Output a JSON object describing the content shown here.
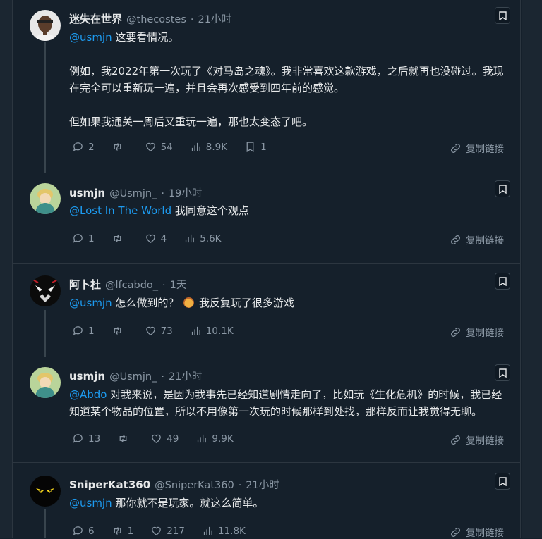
{
  "posts": [
    {
      "name": "迷失在世界",
      "handle": "@thecostes",
      "time": "21小时",
      "mention": "@usmjn",
      "paragraphs": [
        "这要看情况。",
        "例如，我2022年第一次玩了《对马岛之魂》。我非常喜欢这款游戏，之后就再也没碰过。我现在完全可以重新玩一遍，并且会再次感受到四年前的感觉。",
        "但如果我通关一周后又重玩一遍，那也太变态了吧。"
      ],
      "replies": "2",
      "retweets": "",
      "likes": "54",
      "views": "8.9K",
      "bookmarks": "1",
      "copy_link": "复制链接"
    },
    {
      "name": "usmjn",
      "handle": "@Usmjn_",
      "time": "19小时",
      "mention": "@Lost In The World",
      "text": "我同意这个观点",
      "replies": "1",
      "retweets": "",
      "likes": "4",
      "views": "5.6K",
      "copy_link": "复制链接"
    },
    {
      "name": "阿卜杜",
      "handle": "@lfcabdo_",
      "time": "1天",
      "mention": "@usmjn",
      "text_before": "怎么做到的？",
      "text_after": "我反复玩了很多游戏",
      "replies": "1",
      "retweets": "",
      "likes": "73",
      "views": "10.1K",
      "copy_link": "复制链接"
    },
    {
      "name": "usmjn",
      "handle": "@Usmjn_",
      "time": "21小时",
      "mention": "@Abdo",
      "text": "对我来说，是因为我事先已经知道剧情走向了，比如玩《生化危机》的时候，我已经知道某个物品的位置，所以不用像第一次玩的时候那样到处找，那样反而让我觉得无聊。",
      "replies": "13",
      "retweets": "",
      "likes": "49",
      "views": "9.9K",
      "copy_link": "复制链接"
    },
    {
      "name": "SniperKat360",
      "handle": "@SniperKat360",
      "time": "21小时",
      "mention": "@usmjn",
      "text": "那你就不是玩家。就这么简单。",
      "replies": "6",
      "retweets": "1",
      "likes": "217",
      "views": "11.8K",
      "copy_link": "复制链接"
    }
  ],
  "separator_dot": "·",
  "icons": {
    "reply": "reply-icon",
    "retweet": "retweet-icon",
    "like": "heart-icon",
    "views": "views-icon",
    "bookmark": "bookmark-icon",
    "link": "link-icon"
  },
  "colors": {
    "background": "#15202b",
    "mention": "#1d9bf0",
    "muted": "#8b98a5",
    "text": "#e7e9ea"
  }
}
